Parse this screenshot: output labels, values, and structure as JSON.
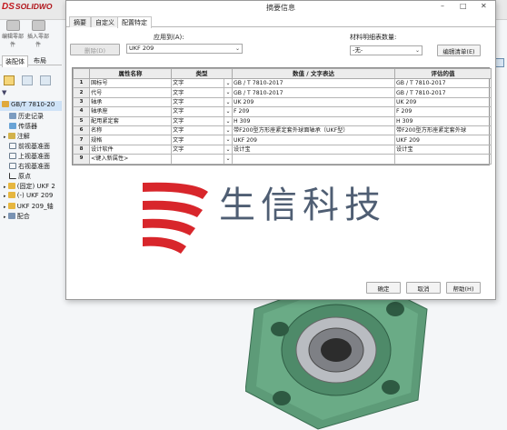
{
  "app": {
    "logo_ds": "DS",
    "logo_text": "SOLIDWO",
    "toolbar_buttons": [
      "编辑零部件",
      "插入零部件"
    ],
    "panel_tabs": [
      "装配体",
      "布局"
    ],
    "tree": {
      "root": "GB/T 7810-20",
      "items": [
        "历史记录",
        "传感器",
        "注解",
        "前视基准面",
        "上视基准面",
        "右视基准面",
        "原点",
        "(固定) UKF 2",
        "(-) UKF 209",
        "UKF 209_轴",
        "配合"
      ]
    }
  },
  "dialog": {
    "title": "摘要信息",
    "controls": {
      "minimize": "–",
      "maximize": "□",
      "close": "✕"
    },
    "tabs": [
      "摘要",
      "自定义",
      "配置特定"
    ],
    "selected_tab": "配置特定",
    "apply_to_label": "应用到(A):",
    "apply_to_value": "UKF 209",
    "delete_button": "删除(D)",
    "bom_qty_label": "材料明细表数量:",
    "bom_qty_value": "-无-",
    "edit_list_button": "编辑清单(E)",
    "columns": [
      "属性名称",
      "类型",
      "数值 / 文字表达",
      "评估的值"
    ],
    "rows": [
      {
        "num": "1",
        "name": "国标号",
        "type": "文字",
        "expr": "GB / T 7810-2017",
        "value": "GB / T 7810-2017"
      },
      {
        "num": "2",
        "name": "代号",
        "type": "文字",
        "expr": "GB / T 7810-2017",
        "value": "GB / T 7810-2017"
      },
      {
        "num": "3",
        "name": "轴承",
        "type": "文字",
        "expr": "UK 209",
        "value": "UK 209"
      },
      {
        "num": "4",
        "name": "轴承座",
        "type": "文字",
        "expr": "F 209",
        "value": "F 209"
      },
      {
        "num": "5",
        "name": "配用紧定套",
        "type": "文字",
        "expr": "H 309",
        "value": "H 309"
      },
      {
        "num": "6",
        "name": "名称",
        "type": "文字",
        "expr": "带F200型方形座紧定套外球面轴承（UKF型）",
        "value": "带F200型方形座紧定套外球"
      },
      {
        "num": "7",
        "name": "规格",
        "type": "文字",
        "expr": "UKF 209",
        "value": "UKF 209"
      },
      {
        "num": "8",
        "name": "设计软件",
        "type": "文字",
        "expr": "设计宝",
        "value": "设计宝"
      },
      {
        "num": "9",
        "name": "<键入新属性>",
        "type": "",
        "expr": "",
        "value": ""
      }
    ],
    "buttons": {
      "ok": "确定",
      "cancel": "取消",
      "help": "帮助(H)"
    }
  },
  "watermark": {
    "text": "生信科技"
  },
  "colors": {
    "logo_red": "#d8262b",
    "watermark_text": "#4f5e73",
    "part_green": "#5d9b78",
    "selected_tree": "#cfe3f7"
  }
}
